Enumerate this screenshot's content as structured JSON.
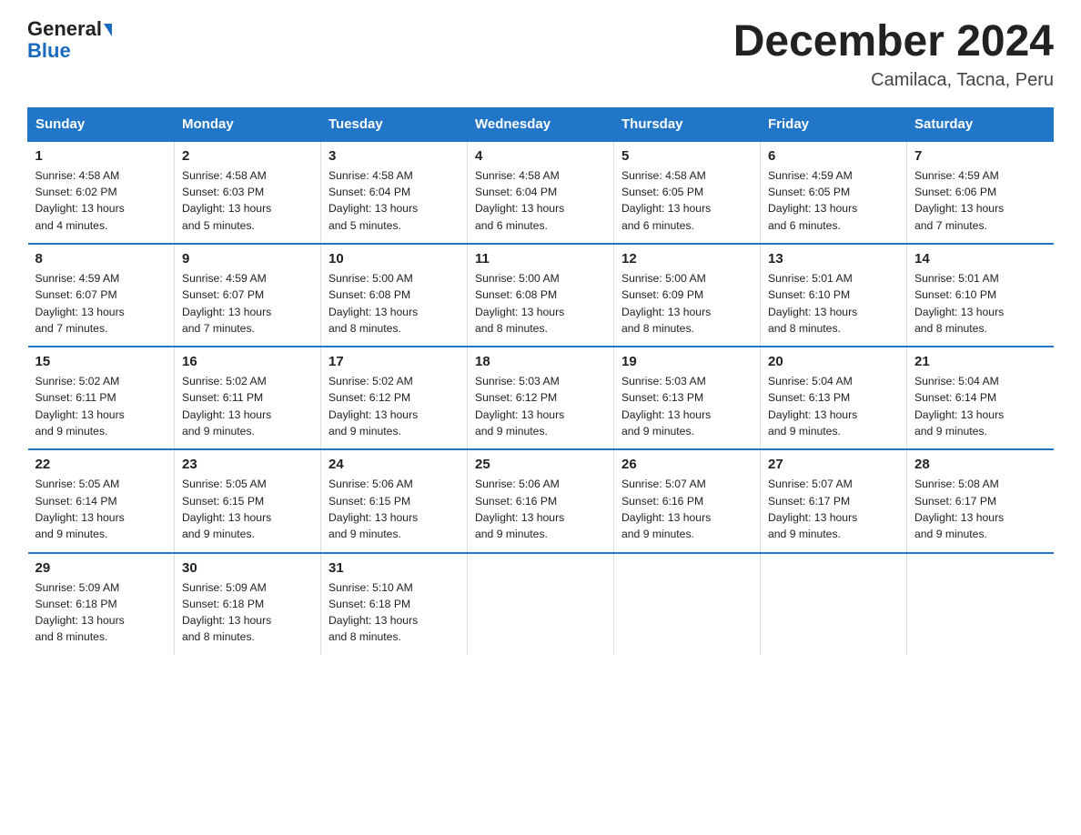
{
  "header": {
    "logo_line1": "General",
    "logo_line2": "Blue",
    "title": "December 2024",
    "subtitle": "Camilaca, Tacna, Peru"
  },
  "days_of_week": [
    "Sunday",
    "Monday",
    "Tuesday",
    "Wednesday",
    "Thursday",
    "Friday",
    "Saturday"
  ],
  "weeks": [
    [
      {
        "day": "1",
        "sunrise": "4:58 AM",
        "sunset": "6:02 PM",
        "daylight": "13 hours and 4 minutes."
      },
      {
        "day": "2",
        "sunrise": "4:58 AM",
        "sunset": "6:03 PM",
        "daylight": "13 hours and 5 minutes."
      },
      {
        "day": "3",
        "sunrise": "4:58 AM",
        "sunset": "6:04 PM",
        "daylight": "13 hours and 5 minutes."
      },
      {
        "day": "4",
        "sunrise": "4:58 AM",
        "sunset": "6:04 PM",
        "daylight": "13 hours and 6 minutes."
      },
      {
        "day": "5",
        "sunrise": "4:58 AM",
        "sunset": "6:05 PM",
        "daylight": "13 hours and 6 minutes."
      },
      {
        "day": "6",
        "sunrise": "4:59 AM",
        "sunset": "6:05 PM",
        "daylight": "13 hours and 6 minutes."
      },
      {
        "day": "7",
        "sunrise": "4:59 AM",
        "sunset": "6:06 PM",
        "daylight": "13 hours and 7 minutes."
      }
    ],
    [
      {
        "day": "8",
        "sunrise": "4:59 AM",
        "sunset": "6:07 PM",
        "daylight": "13 hours and 7 minutes."
      },
      {
        "day": "9",
        "sunrise": "4:59 AM",
        "sunset": "6:07 PM",
        "daylight": "13 hours and 7 minutes."
      },
      {
        "day": "10",
        "sunrise": "5:00 AM",
        "sunset": "6:08 PM",
        "daylight": "13 hours and 8 minutes."
      },
      {
        "day": "11",
        "sunrise": "5:00 AM",
        "sunset": "6:08 PM",
        "daylight": "13 hours and 8 minutes."
      },
      {
        "day": "12",
        "sunrise": "5:00 AM",
        "sunset": "6:09 PM",
        "daylight": "13 hours and 8 minutes."
      },
      {
        "day": "13",
        "sunrise": "5:01 AM",
        "sunset": "6:10 PM",
        "daylight": "13 hours and 8 minutes."
      },
      {
        "day": "14",
        "sunrise": "5:01 AM",
        "sunset": "6:10 PM",
        "daylight": "13 hours and 8 minutes."
      }
    ],
    [
      {
        "day": "15",
        "sunrise": "5:02 AM",
        "sunset": "6:11 PM",
        "daylight": "13 hours and 9 minutes."
      },
      {
        "day": "16",
        "sunrise": "5:02 AM",
        "sunset": "6:11 PM",
        "daylight": "13 hours and 9 minutes."
      },
      {
        "day": "17",
        "sunrise": "5:02 AM",
        "sunset": "6:12 PM",
        "daylight": "13 hours and 9 minutes."
      },
      {
        "day": "18",
        "sunrise": "5:03 AM",
        "sunset": "6:12 PM",
        "daylight": "13 hours and 9 minutes."
      },
      {
        "day": "19",
        "sunrise": "5:03 AM",
        "sunset": "6:13 PM",
        "daylight": "13 hours and 9 minutes."
      },
      {
        "day": "20",
        "sunrise": "5:04 AM",
        "sunset": "6:13 PM",
        "daylight": "13 hours and 9 minutes."
      },
      {
        "day": "21",
        "sunrise": "5:04 AM",
        "sunset": "6:14 PM",
        "daylight": "13 hours and 9 minutes."
      }
    ],
    [
      {
        "day": "22",
        "sunrise": "5:05 AM",
        "sunset": "6:14 PM",
        "daylight": "13 hours and 9 minutes."
      },
      {
        "day": "23",
        "sunrise": "5:05 AM",
        "sunset": "6:15 PM",
        "daylight": "13 hours and 9 minutes."
      },
      {
        "day": "24",
        "sunrise": "5:06 AM",
        "sunset": "6:15 PM",
        "daylight": "13 hours and 9 minutes."
      },
      {
        "day": "25",
        "sunrise": "5:06 AM",
        "sunset": "6:16 PM",
        "daylight": "13 hours and 9 minutes."
      },
      {
        "day": "26",
        "sunrise": "5:07 AM",
        "sunset": "6:16 PM",
        "daylight": "13 hours and 9 minutes."
      },
      {
        "day": "27",
        "sunrise": "5:07 AM",
        "sunset": "6:17 PM",
        "daylight": "13 hours and 9 minutes."
      },
      {
        "day": "28",
        "sunrise": "5:08 AM",
        "sunset": "6:17 PM",
        "daylight": "13 hours and 9 minutes."
      }
    ],
    [
      {
        "day": "29",
        "sunrise": "5:09 AM",
        "sunset": "6:18 PM",
        "daylight": "13 hours and 8 minutes."
      },
      {
        "day": "30",
        "sunrise": "5:09 AM",
        "sunset": "6:18 PM",
        "daylight": "13 hours and 8 minutes."
      },
      {
        "day": "31",
        "sunrise": "5:10 AM",
        "sunset": "6:18 PM",
        "daylight": "13 hours and 8 minutes."
      },
      null,
      null,
      null,
      null
    ]
  ],
  "labels": {
    "sunrise": "Sunrise:",
    "sunset": "Sunset:",
    "daylight": "Daylight:"
  },
  "colors": {
    "header_bg": "#2176c7",
    "border": "#2176c7"
  }
}
